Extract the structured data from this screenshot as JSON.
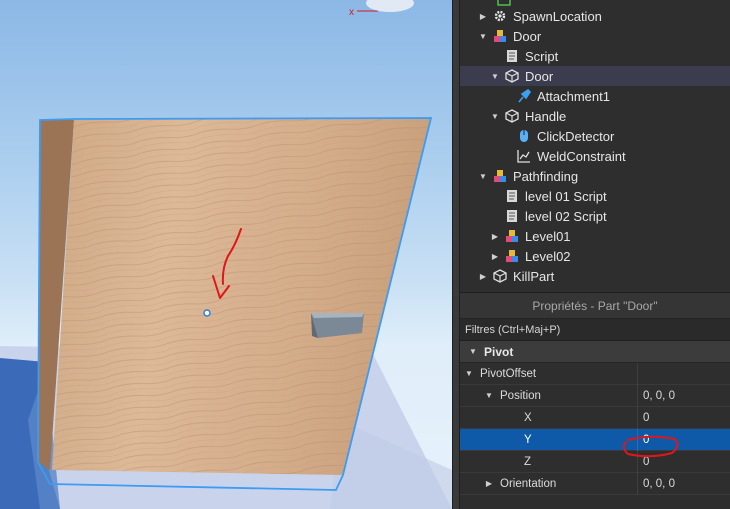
{
  "explorer": {
    "items": [
      {
        "label": "SpawnLocation",
        "icon": "spawn-gear-icon",
        "arrow": "▶"
      },
      {
        "label": "Door",
        "icon": "model-icon",
        "arrow": "▼"
      },
      {
        "label": "Script",
        "icon": "script-icon",
        "arrow": ""
      },
      {
        "label": "Door",
        "icon": "part-icon",
        "arrow": "▼"
      },
      {
        "label": "Attachment1",
        "icon": "attachment-icon",
        "arrow": ""
      },
      {
        "label": "Handle",
        "icon": "part-icon",
        "arrow": "▼"
      },
      {
        "label": "ClickDetector",
        "icon": "click-detector-icon",
        "arrow": ""
      },
      {
        "label": "WeldConstraint",
        "icon": "weld-constraint-icon",
        "arrow": ""
      },
      {
        "label": "Pathfinding",
        "icon": "model-icon",
        "arrow": "▼"
      },
      {
        "label": "level 01 Script",
        "icon": "script-icon",
        "arrow": ""
      },
      {
        "label": "level 02 Script",
        "icon": "script-icon",
        "arrow": ""
      },
      {
        "label": "Level01",
        "icon": "model-icon",
        "arrow": "▶"
      },
      {
        "label": "Level02",
        "icon": "model-icon",
        "arrow": "▶"
      },
      {
        "label": "KillPart",
        "icon": "part-icon",
        "arrow": "▶"
      }
    ]
  },
  "properties": {
    "title": "Propriétés - Part \"Door\"",
    "filter_placeholder": "Filtres (Ctrl+Maj+P)",
    "section": "Pivot",
    "rows": [
      {
        "name": "PivotOffset",
        "value": ""
      },
      {
        "name": "Position",
        "value": "0, 0, 0"
      },
      {
        "name": "X",
        "value": "0"
      },
      {
        "name": "Y",
        "value": "0"
      },
      {
        "name": "Z",
        "value": "0"
      },
      {
        "name": "Orientation",
        "value": "0, 0, 0"
      }
    ]
  },
  "colors": {
    "selection_blue": "#0e5aa8",
    "explorer_selected": "#3b3d4f",
    "annotation_red": "#e0161a",
    "door_outline": "#3d9bf2"
  }
}
